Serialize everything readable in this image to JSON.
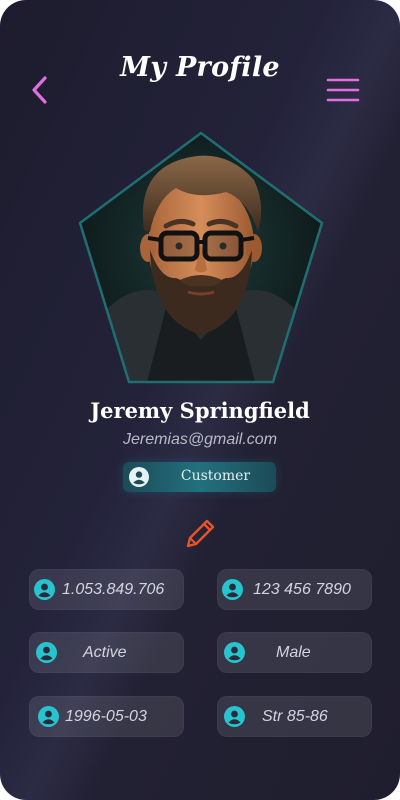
{
  "header": {
    "title": "My Profile",
    "back_icon": "chevron-left-icon",
    "menu_icon": "hamburger-menu-icon"
  },
  "profile": {
    "name": "Jeremy Springfield",
    "email": "Jeremias@gmail.com",
    "role": "Customer",
    "avatar_icon": "user-avatar-photo"
  },
  "edit_icon": "pencil-icon",
  "details": [
    {
      "value": "1.053.849.706",
      "icon": "user-circle-icon"
    },
    {
      "value": "123 456 7890",
      "icon": "user-circle-icon"
    },
    {
      "value": "Active",
      "icon": "user-circle-icon"
    },
    {
      "value": "Male",
      "icon": "user-circle-icon"
    },
    {
      "value": "1996-05-03",
      "icon": "user-circle-icon"
    },
    {
      "value": "Str 85-86",
      "icon": "user-circle-icon"
    }
  ],
  "colors": {
    "accent": "#e070e0",
    "teal": "#27c3cf",
    "edit": "#e8532a",
    "background": "#1f1e2e"
  }
}
